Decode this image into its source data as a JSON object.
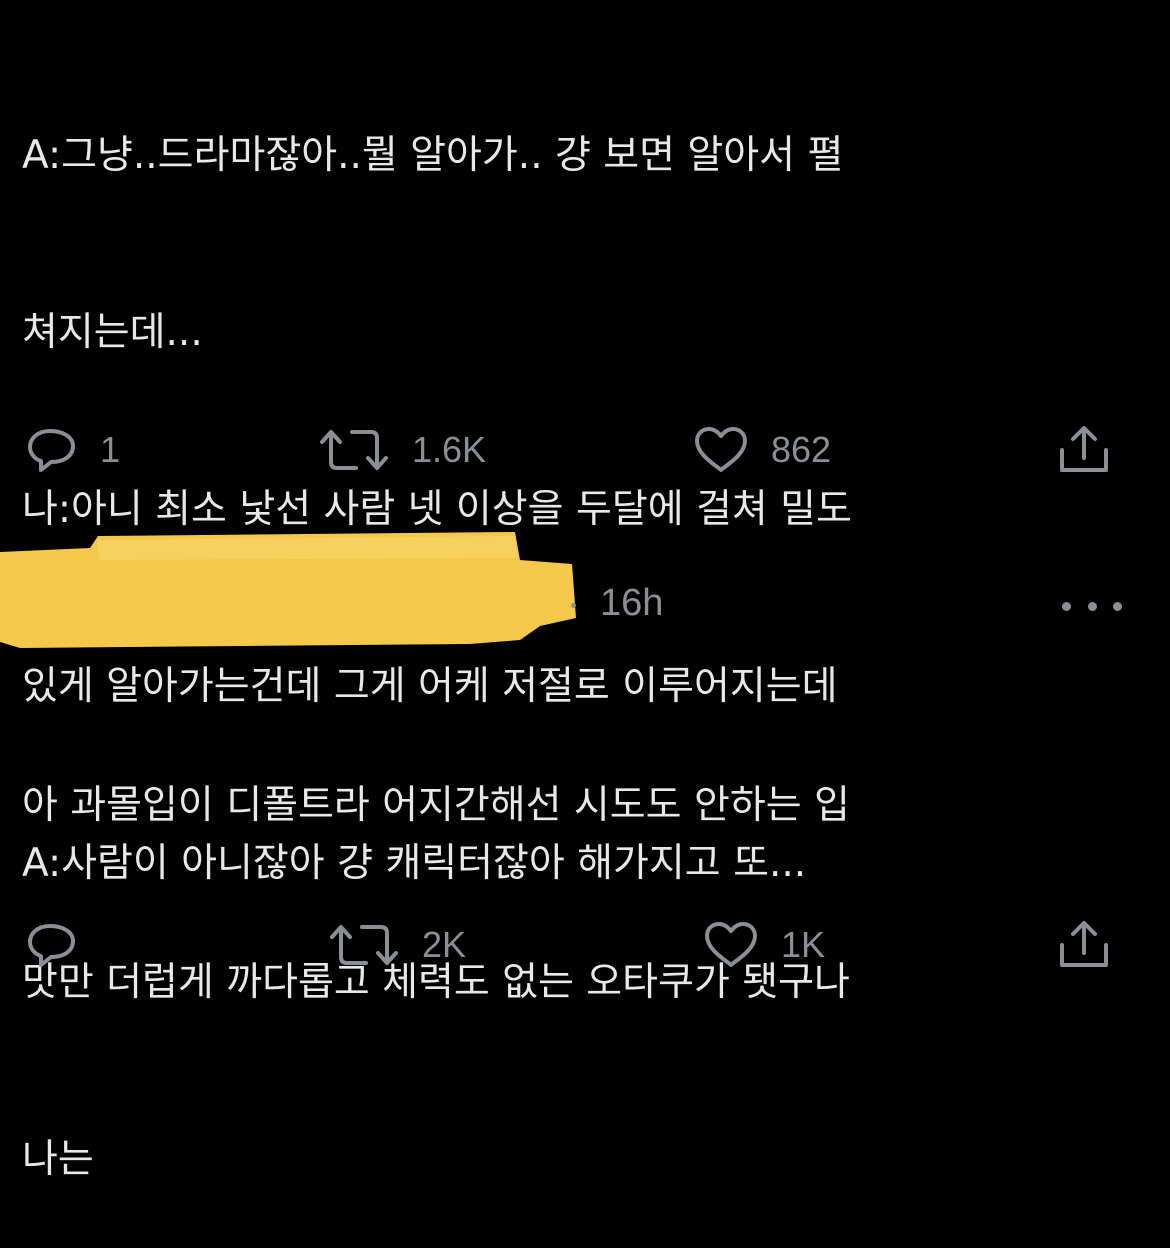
{
  "tweet1": {
    "lines": [
      "A:그냥..드라마잖아..뭘 알아가.. 걍 보면 알아서 펼",
      "쳐지는데...",
      "나:아니 최소 낯선 사람 넷 이상을 두달에 걸쳐 밀도",
      "있게 알아가는건데 그게 어케 저절로 이루어지는데",
      "A:사람이 아니잖아 걍 캐릭터잖아 해가지고 또..."
    ],
    "actions": {
      "reply_count": "1",
      "retweet_count": "1.6K",
      "like_count": "862"
    }
  },
  "tweet2": {
    "timestamp": "16h",
    "lines": [
      "아 과몰입이 디폴트라 어지간해선 시도도 안하는 입",
      "맛만 더럽게 까다롭고 체력도 없는 오타쿠가 됏구나",
      "나는"
    ],
    "actions": {
      "reply_count": "",
      "retweet_count": "2K",
      "like_count": "1K"
    }
  },
  "icons": {
    "reply": "reply-icon",
    "retweet": "retweet-icon",
    "like": "heart-icon",
    "share": "share-icon",
    "more": "more-icon"
  },
  "colors": {
    "background": "#000000",
    "text": "#e8e8e8",
    "muted": "#8b8f94",
    "redaction": "#f4c84a"
  }
}
